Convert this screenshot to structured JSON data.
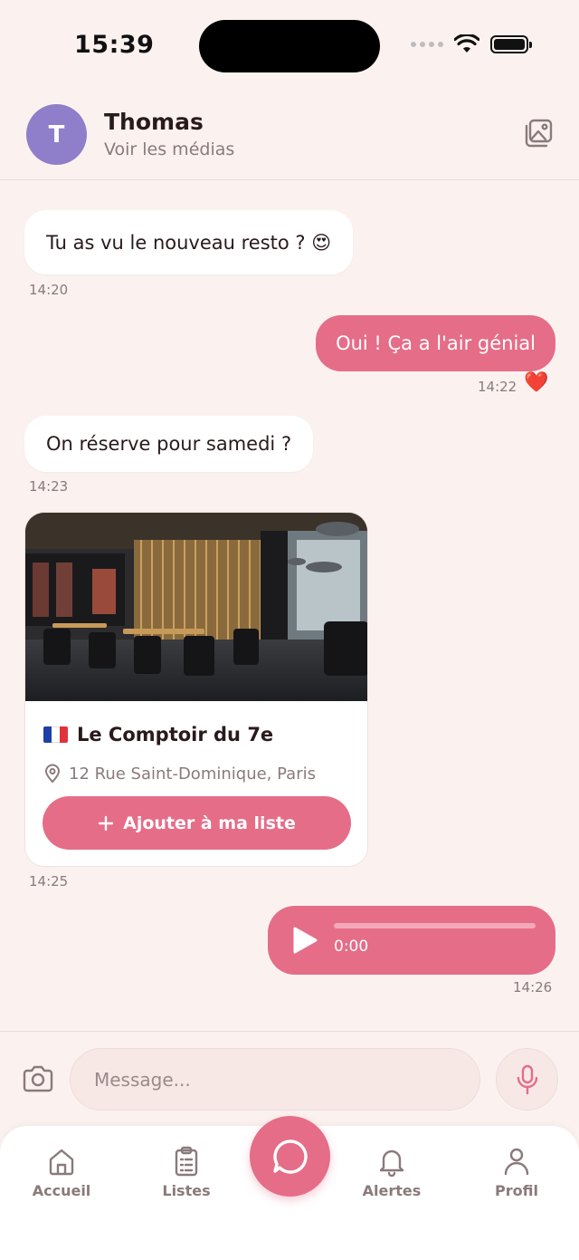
{
  "status_bar": {
    "time": "15:39"
  },
  "header": {
    "avatar_initial": "T",
    "name": "Thomas",
    "subtitle": "Voir les médias",
    "media_icon": "gallery-icon"
  },
  "messages": [
    {
      "direction": "in",
      "text": "Tu as vu le nouveau resto ? 😍",
      "time": "14:20"
    },
    {
      "direction": "out",
      "text": "Oui ! Ça a l'air génial",
      "time": "14:22",
      "reaction": "❤️"
    },
    {
      "direction": "in",
      "text": "On réserve pour samedi ?",
      "time": "14:23"
    }
  ],
  "restaurant_card": {
    "name": "Le Comptoir du 7e",
    "address": "12 Rue Saint-Dominique, Paris",
    "button_label": "Ajouter à ma liste",
    "button_icon": "plus-icon",
    "time": "14:25",
    "colors": {
      "flag_blue": "#1f3fa8",
      "flag_white": "#ffffff",
      "flag_red": "#e0323a"
    }
  },
  "voice_message": {
    "duration": "0:00",
    "progress": 0,
    "time": "14:26",
    "icon": "play-icon"
  },
  "composer": {
    "placeholder": "Message...",
    "value": "",
    "left_icon": "camera-icon",
    "right_icon": "microphone-icon"
  },
  "tabbar": {
    "items": [
      {
        "label": "Accueil",
        "icon": "home-icon"
      },
      {
        "label": "Listes",
        "icon": "clipboard-icon"
      },
      {
        "label": "",
        "icon": "chat-bubble-icon",
        "active": true
      },
      {
        "label": "Alertes",
        "icon": "bell-icon"
      },
      {
        "label": "Profil",
        "icon": "user-icon"
      }
    ]
  },
  "colors": {
    "accent": "#e56d88",
    "background": "#fbf2f0",
    "avatar": "#8f7ec9",
    "muted_text": "#8a7a7b"
  }
}
